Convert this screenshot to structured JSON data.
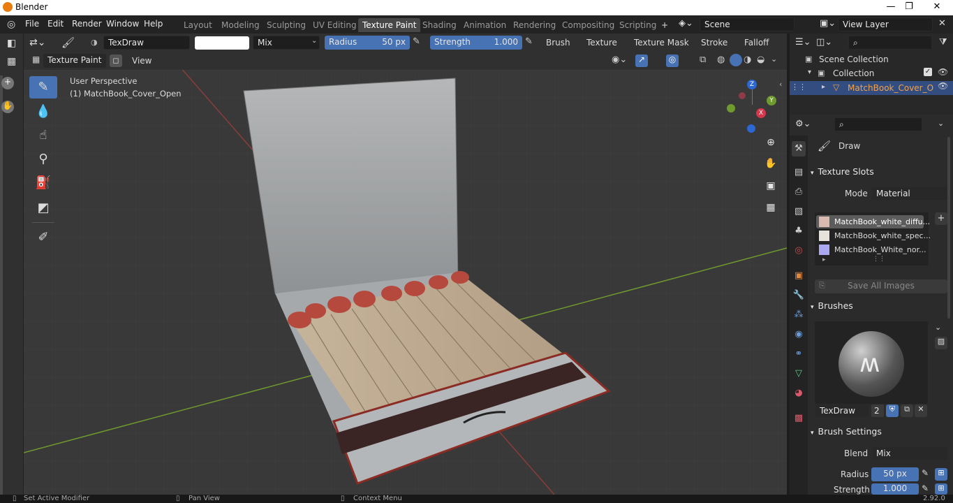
{
  "window": {
    "title": "Blender",
    "min": "—",
    "max": "❐",
    "close": "✕"
  },
  "menus": [
    "File",
    "Edit",
    "Render",
    "Window",
    "Help"
  ],
  "workspaces": [
    "Layout",
    "Modeling",
    "Sculpting",
    "UV Editing",
    "Texture Paint",
    "Shading",
    "Animation",
    "Rendering",
    "Compositing",
    "Scripting"
  ],
  "workspace_add": "+",
  "scene": {
    "name": "Scene",
    "view_layer": "View Layer"
  },
  "tool_header": {
    "brush_name": "TexDraw",
    "blend": "Mix",
    "radius_label": "Radius",
    "radius_value": "50 px",
    "strength_label": "Strength",
    "strength_value": "1.000",
    "menus": [
      "Brush",
      "Texture",
      "Texture Mask",
      "Stroke",
      "Falloff"
    ]
  },
  "viewport_header": {
    "mode": "Texture Paint",
    "view": "View"
  },
  "viewport": {
    "perspective": "User Perspective",
    "object": "(1) MatchBook_Cover_Open",
    "gizmo": {
      "x": "X",
      "y": "Y",
      "z": "Z"
    }
  },
  "outliner": {
    "root": "Scene Collection",
    "collection": "Collection",
    "object": "MatchBook_Cover_O"
  },
  "properties": {
    "tool_name": "Draw",
    "texture_slots_title": "Texture Slots",
    "mode_label": "Mode",
    "mode_value": "Material",
    "slots": [
      "MatchBook_white_diffu...",
      "MatchBook_white_spec...",
      "MatchBook_White_nor..."
    ],
    "save_all": "Save All Images",
    "brushes_title": "Brushes",
    "brush_name": "TexDraw",
    "brush_users": "2",
    "brush_settings_title": "Brush Settings",
    "blend_label": "Blend",
    "blend_value": "Mix",
    "radius_label": "Radius",
    "radius_value": "50 px",
    "strength_label": "Strength",
    "strength_value": "1.000"
  },
  "status": {
    "left": "Set Active Modifier",
    "mid": "Pan View",
    "right": "Context Menu",
    "version": "2.92.0"
  }
}
